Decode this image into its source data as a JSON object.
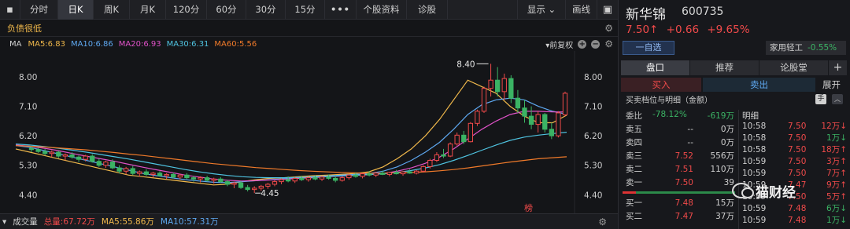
{
  "tabs": [
    {
      "label": "分时",
      "width": 48
    },
    {
      "label": "日K",
      "width": 45,
      "active": true
    },
    {
      "label": "周K",
      "width": 46
    },
    {
      "label": "月K",
      "width": 46
    },
    {
      "label": "120分",
      "width": 52
    },
    {
      "label": "60分",
      "width": 50
    },
    {
      "label": "30分",
      "width": 50
    },
    {
      "label": "15分",
      "width": 50
    }
  ],
  "tabs_more": "•••",
  "tabs_right": [
    "个股资料",
    "诊股"
  ],
  "display_label": "显示 ⌄",
  "draw_label": "画线",
  "debt_label": "负债很低",
  "ma": {
    "prefix": "MA",
    "items": [
      {
        "text": "MA5:6.83",
        "color": "#f0b84b"
      },
      {
        "text": "MA10:6.86",
        "color": "#5ea8f0"
      },
      {
        "text": "MA20:6.93",
        "color": "#e052c8"
      },
      {
        "text": "MA30:6.31",
        "color": "#4fc3e0"
      },
      {
        "text": "MA60:5.56",
        "color": "#f07a2a"
      }
    ],
    "adjust": "前复权"
  },
  "chart_data": {
    "type": "candlestick",
    "ylim": [
      4.0,
      8.6
    ],
    "y_ticks": [
      "8.00",
      "7.10",
      "6.20",
      "5.30",
      "4.40"
    ],
    "high_annotation": "8.40",
    "low_annotation": "4.45",
    "marker": "榜",
    "candles": [
      [
        5.82,
        5.88,
        5.7,
        5.78
      ],
      [
        5.78,
        5.84,
        5.68,
        5.72
      ],
      [
        5.72,
        5.8,
        5.6,
        5.66
      ],
      [
        5.66,
        5.75,
        5.55,
        5.7
      ],
      [
        5.7,
        5.74,
        5.52,
        5.58
      ],
      [
        5.58,
        5.66,
        5.45,
        5.62
      ],
      [
        5.62,
        5.7,
        5.5,
        5.55
      ],
      [
        5.55,
        5.6,
        5.4,
        5.48
      ],
      [
        5.48,
        5.62,
        5.42,
        5.58
      ],
      [
        5.58,
        5.64,
        5.38,
        5.42
      ],
      [
        5.42,
        5.5,
        5.25,
        5.3
      ],
      [
        5.3,
        5.44,
        5.22,
        5.4
      ],
      [
        5.4,
        5.48,
        5.18,
        5.22
      ],
      [
        5.22,
        5.3,
        5.05,
        5.12
      ],
      [
        5.12,
        5.25,
        5.02,
        5.2
      ],
      [
        5.2,
        5.28,
        5.0,
        5.05
      ],
      [
        5.05,
        5.14,
        4.95,
        5.1
      ],
      [
        5.1,
        5.18,
        4.98,
        5.02
      ],
      [
        5.02,
        5.1,
        4.92,
        5.06
      ],
      [
        5.06,
        5.12,
        4.95,
        4.98
      ],
      [
        4.98,
        5.06,
        4.88,
        5.02
      ],
      [
        5.02,
        5.08,
        4.9,
        4.94
      ],
      [
        4.94,
        5.04,
        4.86,
        5.0
      ],
      [
        5.0,
        5.06,
        4.88,
        4.92
      ],
      [
        4.92,
        4.98,
        4.8,
        4.88
      ],
      [
        4.88,
        4.96,
        4.78,
        4.92
      ],
      [
        4.92,
        4.98,
        4.8,
        4.84
      ],
      [
        4.84,
        4.92,
        4.74,
        4.88
      ],
      [
        4.88,
        4.94,
        4.76,
        4.8
      ],
      [
        4.8,
        4.86,
        4.66,
        4.72
      ],
      [
        4.72,
        4.8,
        4.6,
        4.76
      ],
      [
        4.76,
        4.82,
        4.58,
        4.62
      ],
      [
        4.62,
        4.7,
        4.5,
        4.56
      ],
      [
        4.56,
        4.66,
        4.45,
        4.6
      ],
      [
        4.6,
        4.7,
        4.52,
        4.66
      ],
      [
        4.66,
        4.76,
        4.58,
        4.72
      ],
      [
        4.72,
        4.84,
        4.66,
        4.8
      ],
      [
        4.8,
        4.9,
        4.72,
        4.86
      ],
      [
        4.86,
        4.96,
        4.78,
        4.82
      ],
      [
        4.82,
        4.94,
        4.76,
        4.9
      ],
      [
        4.9,
        4.98,
        4.82,
        4.86
      ],
      [
        4.86,
        4.96,
        4.8,
        4.92
      ],
      [
        4.92,
        5.0,
        4.84,
        4.88
      ],
      [
        4.88,
        4.98,
        4.82,
        4.94
      ],
      [
        4.94,
        5.02,
        4.86,
        4.9
      ],
      [
        4.9,
        4.98,
        4.78,
        4.84
      ],
      [
        4.84,
        4.96,
        4.8,
        4.92
      ],
      [
        4.92,
        5.04,
        4.86,
        5.0
      ],
      [
        5.0,
        5.08,
        4.92,
        4.96
      ],
      [
        4.96,
        5.06,
        4.9,
        5.04
      ],
      [
        5.04,
        5.12,
        4.96,
        5.0
      ],
      [
        5.0,
        5.1,
        4.94,
        5.06
      ],
      [
        5.06,
        5.14,
        5.0,
        5.02
      ],
      [
        5.02,
        5.1,
        4.96,
        5.08
      ],
      [
        5.08,
        5.16,
        5.02,
        5.04
      ],
      [
        5.04,
        5.12,
        4.98,
        5.1
      ],
      [
        5.1,
        5.18,
        5.04,
        5.06
      ],
      [
        5.06,
        5.16,
        5.02,
        5.12
      ],
      [
        5.12,
        5.3,
        5.08,
        5.26
      ],
      [
        5.26,
        5.5,
        5.2,
        5.45
      ],
      [
        5.45,
        5.7,
        5.4,
        5.62
      ],
      [
        5.62,
        5.8,
        5.52,
        5.58
      ],
      [
        5.58,
        6.0,
        5.55,
        5.95
      ],
      [
        5.95,
        6.3,
        5.9,
        6.22
      ],
      [
        6.22,
        6.35,
        5.95,
        6.02
      ],
      [
        6.02,
        6.62,
        6.0,
        6.58
      ],
      [
        6.58,
        7.0,
        6.5,
        6.95
      ],
      [
        6.95,
        7.7,
        6.9,
        7.65
      ],
      [
        7.65,
        8.4,
        7.4,
        7.9
      ],
      [
        7.9,
        8.3,
        7.4,
        7.55
      ],
      [
        7.55,
        8.1,
        7.3,
        7.95
      ],
      [
        7.95,
        8.05,
        7.2,
        7.35
      ],
      [
        7.35,
        7.6,
        6.9,
        7.05
      ],
      [
        7.05,
        7.3,
        6.6,
        6.8
      ],
      [
        6.8,
        7.1,
        6.4,
        6.55
      ],
      [
        6.55,
        6.95,
        6.3,
        6.85
      ],
      [
        6.85,
        6.9,
        6.3,
        6.4
      ],
      [
        6.4,
        6.6,
        6.1,
        6.2
      ],
      [
        6.2,
        6.95,
        6.15,
        6.9
      ],
      [
        6.84,
        7.55,
        6.8,
        7.5
      ]
    ],
    "ma_series": [
      {
        "name": "MA5",
        "color": "#f0b84b",
        "start": 0,
        "values": [
          5.8,
          5.7,
          5.6,
          5.5,
          5.4,
          5.3,
          5.2,
          5.1,
          5.0,
          4.95,
          4.9,
          4.85,
          4.8,
          4.75,
          4.7,
          4.72,
          4.8,
          4.86,
          4.9,
          4.92,
          4.95,
          4.98,
          5.0,
          5.02,
          5.05,
          5.1,
          5.25,
          5.5,
          5.8,
          6.2,
          6.7,
          7.3,
          7.9,
          7.7,
          7.5,
          7.1,
          6.8,
          6.6,
          6.6,
          6.83
        ]
      },
      {
        "name": "MA10",
        "color": "#5ea8f0",
        "start": 0,
        "values": [
          5.9,
          5.85,
          5.75,
          5.65,
          5.55,
          5.45,
          5.35,
          5.25,
          5.15,
          5.05,
          4.98,
          4.92,
          4.86,
          4.82,
          4.78,
          4.77,
          4.8,
          4.83,
          4.86,
          4.89,
          4.92,
          4.95,
          4.97,
          5.0,
          5.02,
          5.05,
          5.12,
          5.25,
          5.45,
          5.7,
          6.0,
          6.4,
          6.85,
          7.15,
          7.3,
          7.35,
          7.3,
          7.1,
          6.95,
          6.86
        ]
      },
      {
        "name": "MA20",
        "color": "#e052c8",
        "start": 0,
        "values": [
          5.92,
          5.88,
          5.82,
          5.75,
          5.66,
          5.58,
          5.5,
          5.42,
          5.33,
          5.24,
          5.16,
          5.08,
          5.0,
          4.94,
          4.88,
          4.84,
          4.82,
          4.83,
          4.85,
          4.87,
          4.9,
          4.92,
          4.95,
          4.97,
          4.99,
          5.01,
          5.05,
          5.12,
          5.22,
          5.36,
          5.55,
          5.8,
          6.1,
          6.4,
          6.65,
          6.85,
          6.95,
          6.95,
          6.93,
          6.93
        ]
      },
      {
        "name": "MA30",
        "color": "#4fc3e0",
        "start": 0,
        "values": [
          5.95,
          5.92,
          5.87,
          5.82,
          5.76,
          5.7,
          5.63,
          5.56,
          5.49,
          5.41,
          5.33,
          5.25,
          5.17,
          5.1,
          5.04,
          4.99,
          4.95,
          4.93,
          4.92,
          4.92,
          4.93,
          4.94,
          4.96,
          4.98,
          5.0,
          5.02,
          5.04,
          5.08,
          5.14,
          5.22,
          5.32,
          5.45,
          5.6,
          5.76,
          5.92,
          6.06,
          6.16,
          6.22,
          6.27,
          6.31
        ]
      },
      {
        "name": "MA60",
        "color": "#f07a2a",
        "start": 0,
        "values": [
          5.9,
          5.88,
          5.86,
          5.83,
          5.8,
          5.77,
          5.73,
          5.69,
          5.64,
          5.6,
          5.55,
          5.5,
          5.45,
          5.4,
          5.35,
          5.31,
          5.27,
          5.23,
          5.2,
          5.17,
          5.14,
          5.12,
          5.1,
          5.08,
          5.07,
          5.06,
          5.06,
          5.07,
          5.08,
          5.1,
          5.13,
          5.17,
          5.22,
          5.28,
          5.34,
          5.4,
          5.45,
          5.5,
          5.53,
          5.56
        ]
      }
    ]
  },
  "volume": {
    "label": "成交量",
    "total": "总量:67.72万",
    "ma5": "MA5:55.86万",
    "ma10": "MA10:57.31万"
  },
  "stock": {
    "name": "新华锦",
    "code": "600735",
    "price": "7.50↑",
    "change": "+0.66",
    "pct": "+9.65%",
    "select_label": "一自选",
    "sector": "家用轻工",
    "sector_change": "-0.55%"
  },
  "right_tabs": [
    "盘口",
    "推荐",
    "论股堂",
    "+"
  ],
  "trade": {
    "buy": "买入",
    "sell": "卖出",
    "expand": "展开"
  },
  "detail_title": "买卖档位与明细（金额）",
  "detail_hand": "手",
  "weibi": {
    "label": "委比",
    "ratio": "-78.12%",
    "diff": "-619万"
  },
  "ask_levels": [
    {
      "label": "卖五",
      "price": "--",
      "vol": "0万",
      "color": "white"
    },
    {
      "label": "卖四",
      "price": "--",
      "vol": "0万",
      "color": "white"
    },
    {
      "label": "卖三",
      "price": "7.52",
      "vol": "556万",
      "color": "red"
    },
    {
      "label": "卖二",
      "price": "7.51",
      "vol": "110万",
      "color": "red"
    },
    {
      "label": "卖一",
      "price": "7.50",
      "vol": "39",
      "color": "red"
    }
  ],
  "bid_levels": [
    {
      "label": "买一",
      "price": "7.48",
      "vol": "15万",
      "color": "red"
    },
    {
      "label": "买二",
      "price": "7.47",
      "vol": "37万",
      "color": "red"
    }
  ],
  "ticks_title": "明细",
  "ticks": [
    {
      "time": "10:58",
      "price": "7.50",
      "vol": "12万↓",
      "pc": "red",
      "vc": "red"
    },
    {
      "time": "10:58",
      "price": "7.50",
      "vol": "1万↓",
      "pc": "red",
      "vc": "green"
    },
    {
      "time": "10:58",
      "price": "7.50",
      "vol": "18万↑",
      "pc": "red",
      "vc": "red"
    },
    {
      "time": "10:59",
      "price": "7.50",
      "vol": "3万↑",
      "pc": "red",
      "vc": "red"
    },
    {
      "time": "10:59",
      "price": "7.50",
      "vol": "7万↑",
      "pc": "red",
      "vc": "red"
    },
    {
      "time": "10:59",
      "price": "7.47",
      "vol": "9万↑",
      "pc": "red",
      "vc": "red"
    },
    {
      "time": "10:59",
      "price": "7.50",
      "vol": "5万↑",
      "pc": "red",
      "vc": "red"
    },
    {
      "time": "10:59",
      "price": "7.48",
      "vol": "6万↓",
      "pc": "red",
      "vc": "green"
    },
    {
      "time": "10:59",
      "price": "7.48",
      "vol": "1万↓",
      "pc": "red",
      "vc": "green"
    }
  ],
  "watermark": "猫财经"
}
